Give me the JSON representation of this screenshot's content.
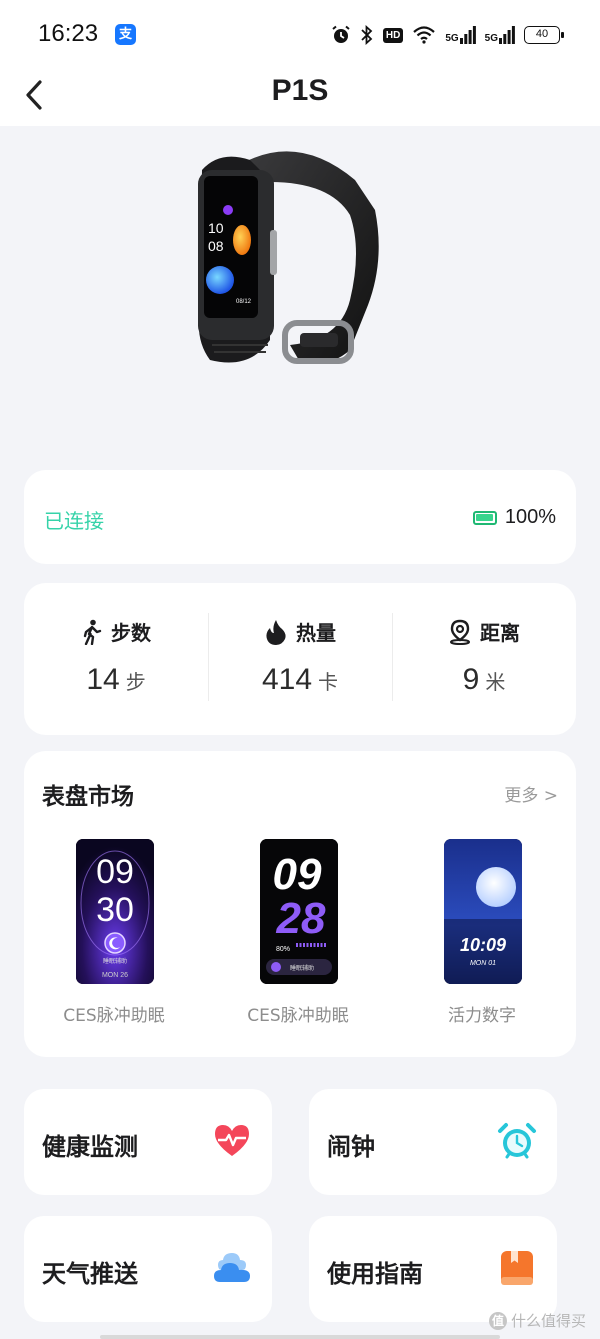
{
  "status_bar": {
    "time": "16:23",
    "app_icon_glyph": "支",
    "hd_label": "HD",
    "net1_label": "5G",
    "net2_label": "5G",
    "battery": "40"
  },
  "nav": {
    "title": "P1S",
    "back_icon": "chevron-left-icon"
  },
  "connection": {
    "status": "已连接",
    "battery_percent": "100%",
    "status_color": "#36d3a9"
  },
  "stats": [
    {
      "label": "步数",
      "value": "14",
      "unit": "步",
      "icon": "walking-icon"
    },
    {
      "label": "热量",
      "value": "414",
      "unit": "卡",
      "icon": "flame-icon"
    },
    {
      "label": "距离",
      "value": "9",
      "unit": "米",
      "icon": "location-pin-icon"
    }
  ],
  "dial_market": {
    "title": "表盘市场",
    "more": "更多 >",
    "items": [
      {
        "name": "CES脉冲助眠",
        "face_hour": "09",
        "face_min": "30",
        "face_sub": "睡眠辅助",
        "face_date": "MON 26"
      },
      {
        "name": "CES脉冲助眠",
        "face_hour": "09",
        "face_min": "28",
        "face_battery": "80%",
        "face_sub": "睡眠辅助"
      },
      {
        "name": "活力数字",
        "face_time": "10:09",
        "face_date": "MON 01"
      }
    ]
  },
  "tiles": [
    {
      "label": "健康监测",
      "icon": "heart-rate-icon",
      "color": "#f4465a"
    },
    {
      "label": "闹钟",
      "icon": "alarm-clock-icon",
      "color": "#27c6d9"
    },
    {
      "label": "天气推送",
      "icon": "cloud-icon",
      "color": "#3a8ef0"
    },
    {
      "label": "使用指南",
      "icon": "guide-book-icon",
      "color": "#f5762c"
    }
  ],
  "watermark": {
    "mark": "值",
    "text": "什么值得买"
  },
  "device_screen": {
    "hour": "10",
    "min": "08",
    "date": "08/12"
  }
}
